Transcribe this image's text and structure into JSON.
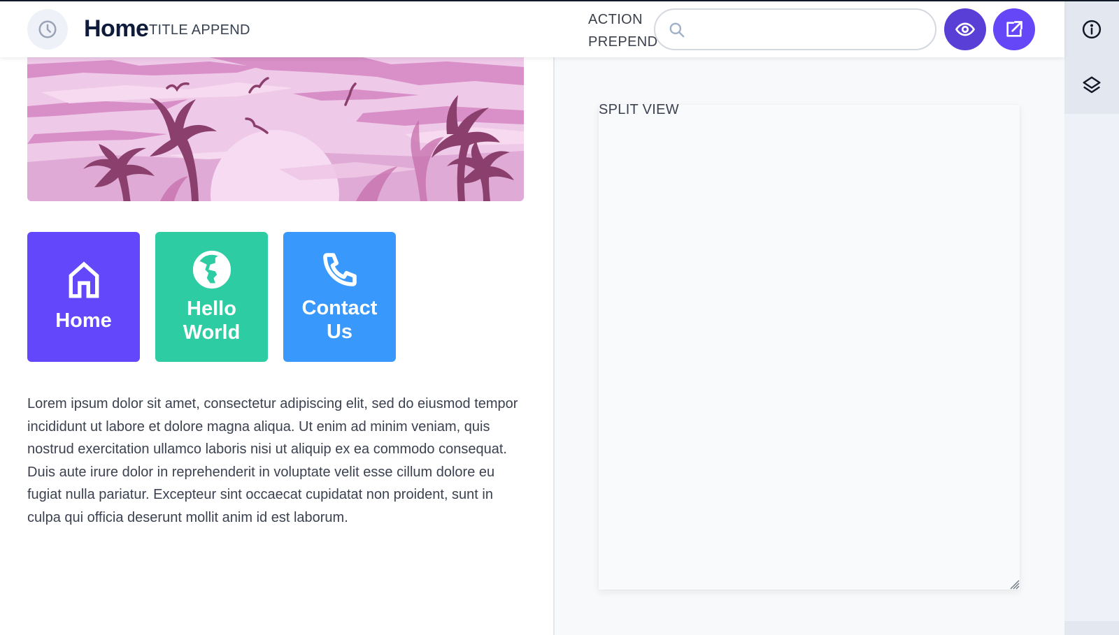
{
  "header": {
    "title": "Home",
    "title_append": "TITLE APPEND",
    "action_prepend_line1": "ACTION",
    "action_prepend_line2": "PREPEND",
    "search": {
      "value": "",
      "placeholder": ""
    },
    "history_icon": "clock-icon",
    "buttons": [
      {
        "name": "preview",
        "icon": "eye-icon",
        "color": "#5a3fd6"
      },
      {
        "name": "open-external",
        "icon": "external-link-icon",
        "color": "#6547f7"
      }
    ]
  },
  "hero": {
    "alt": "Pink tropical sunset with palm trees and birds"
  },
  "tiles": [
    {
      "label_line1": "Home",
      "label_line2": "",
      "icon": "home-icon",
      "color": "#6347fb"
    },
    {
      "label_line1": "Hello",
      "label_line2": "World",
      "icon": "globe-icon",
      "color": "#2ecca3"
    },
    {
      "label_line1": "Contact",
      "label_line2": "Us",
      "icon": "phone-icon",
      "color": "#3898fc"
    }
  ],
  "body_text": "Lorem ipsum dolor sit amet, consectetur adipiscing elit, sed do eiusmod tempor incididunt ut labore et dolore magna aliqua. Ut enim ad minim veniam, quis nostrud exercitation ullamco laboris nisi ut aliquip ex ea commodo consequat. Duis aute irure dolor in reprehenderit in voluptate velit esse cillum dolore eu fugiat nulla pariatur. Excepteur sint occaecat cupidatat non proident, sunt in culpa qui officia deserunt mollit anim id est laborum.",
  "split_view": {
    "label": "SPLIT VIEW"
  },
  "rail": {
    "items": [
      {
        "name": "info",
        "icon": "info-icon"
      },
      {
        "name": "layers",
        "icon": "layers-icon"
      }
    ]
  }
}
